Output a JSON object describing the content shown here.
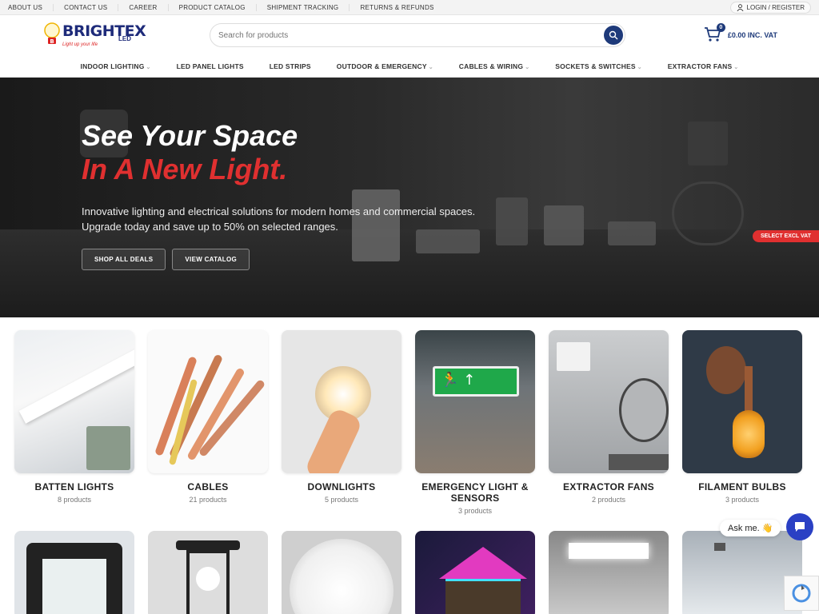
{
  "topbar": {
    "links": [
      "ABOUT US",
      "CONTACT US",
      "CAREER",
      "PRODUCT CATALOG",
      "SHIPMENT TRACKING",
      "RETURNS & REFUNDS"
    ],
    "login": "LOGIN / REGISTER"
  },
  "logo": {
    "brand": "BRIGHTEX",
    "sub": "LED",
    "tagline": "Light up your life"
  },
  "search": {
    "placeholder": "Search for products"
  },
  "cart": {
    "count": "0",
    "total": "£0.00 INC. VAT"
  },
  "nav": {
    "items": [
      "INDOOR LIGHTING",
      "LED PANEL LIGHTS",
      "LED STRIPS",
      "OUTDOOR & EMERGENCY",
      "CABLES & WIRING",
      "SOCKETS & SWITCHES",
      "EXTRACTOR FANS"
    ],
    "has_dropdown": [
      true,
      false,
      false,
      true,
      true,
      true,
      true
    ]
  },
  "hero": {
    "line1": "See Your Space",
    "line2": "In A New Light.",
    "description": "Innovative lighting and electrical solutions for modern homes and commercial spaces. Upgrade today and save up to 50% on selected ranges.",
    "btn1": "SHOP ALL DEALS",
    "btn2": "VIEW CATALOG"
  },
  "vat_toggle": "SELECT EXCL VAT",
  "categories": [
    {
      "name": "BATTEN LIGHTS",
      "count": "8 products"
    },
    {
      "name": "CABLES",
      "count": "21 products"
    },
    {
      "name": "DOWNLIGHTS",
      "count": "5 products"
    },
    {
      "name": "EMERGENCY LIGHT & SENSORS",
      "count": "3 products"
    },
    {
      "name": "EXTRACTOR FANS",
      "count": "2 products"
    },
    {
      "name": "FILAMENT BULBS",
      "count": "3 products"
    }
  ],
  "chat": {
    "label": "Ask me. 👋"
  },
  "colors": {
    "brand_blue": "#1e3a7a",
    "accent_red": "#e03030",
    "chat_blue": "#2a40c4"
  }
}
